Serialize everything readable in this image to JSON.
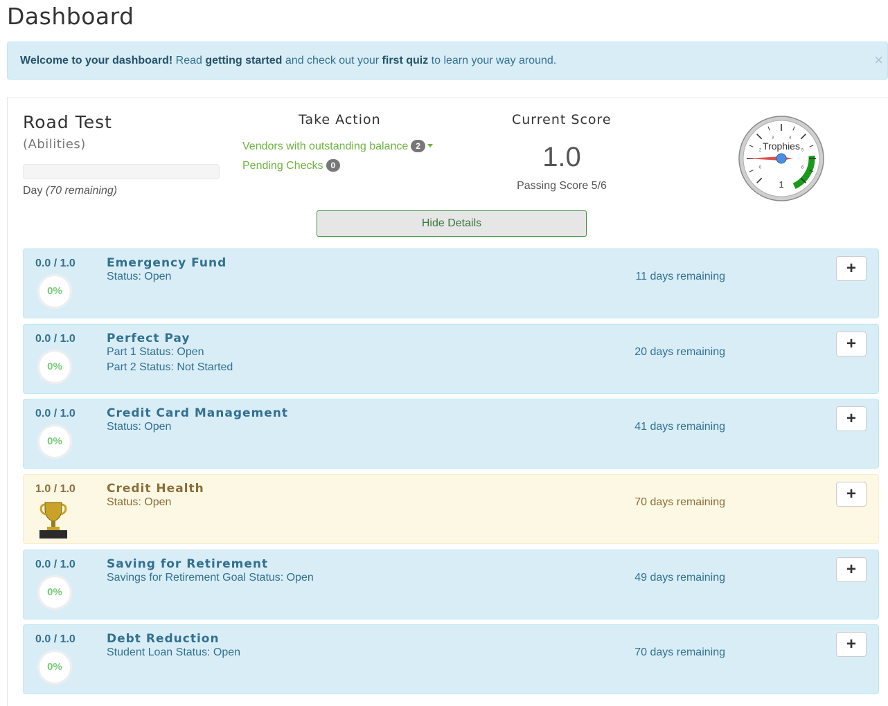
{
  "page": {
    "title": "Dashboard"
  },
  "alert": {
    "lead": "Welcome to your dashboard!",
    "t1": " Read ",
    "link1": "getting started",
    "t2": " and check out your ",
    "link2": "first quiz",
    "t3": " to learn your way around.",
    "close": "×"
  },
  "road_test": {
    "title": "Road Test",
    "subtitle": "(Abilities)",
    "progress": 0,
    "day_label": "Day ",
    "day_remaining": "(70 remaining)"
  },
  "take_action": {
    "heading": "Take Action",
    "vendors_label": "Vendors with outstanding balance",
    "vendors_count": "2",
    "pending_label": "Pending Checks",
    "pending_count": "0"
  },
  "current_score": {
    "heading": "Current Score",
    "value": "1.0",
    "passing": "Passing Score 5/6"
  },
  "gauge": {
    "label": "Trophies",
    "value": "1",
    "ticks": [
      "0",
      "2",
      "3",
      "4",
      "5",
      "6"
    ],
    "accent": "#1a9a1a",
    "needle_color": "#d9534f",
    "hub_color": "#4a90e2"
  },
  "hide_button": "Hide Details",
  "cards": [
    {
      "score": "0.0 / 1.0",
      "pct": "0%",
      "name": "Emergency Fund",
      "lines": [
        "Status: Open"
      ],
      "days": "11 days remaining",
      "plus": "+"
    },
    {
      "score": "0.0 / 1.0",
      "pct": "0%",
      "name": "Perfect Pay",
      "lines": [
        "Part 1 Status: Open",
        "Part 2 Status: Not Started"
      ],
      "days": "20 days remaining",
      "plus": "+"
    },
    {
      "score": "0.0 / 1.0",
      "pct": "0%",
      "name": "Credit Card Management",
      "lines": [
        "Status: Open"
      ],
      "days": "41 days remaining",
      "plus": "+"
    },
    {
      "score": "1.0 / 1.0",
      "pct": "",
      "name": "Credit Health",
      "lines": [
        "Status: Open"
      ],
      "days": "70 days remaining",
      "plus": "+"
    },
    {
      "score": "0.0 / 1.0",
      "pct": "0%",
      "name": "Saving for Retirement",
      "lines": [
        "Savings for Retirement Goal Status: Open"
      ],
      "days": "49 days remaining",
      "plus": "+"
    },
    {
      "score": "0.0 / 1.0",
      "pct": "0%",
      "name": "Debt Reduction",
      "lines": [
        "Student Loan Status: Open"
      ],
      "days": "70 days remaining",
      "plus": "+"
    }
  ]
}
